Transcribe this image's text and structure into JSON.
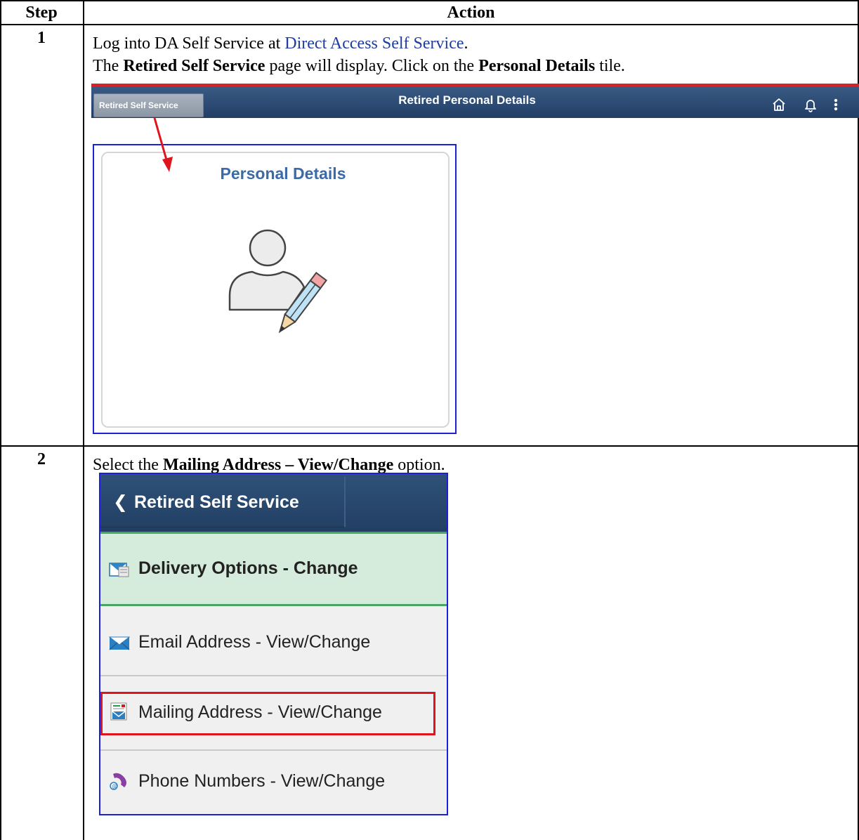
{
  "table": {
    "headers": {
      "step": "Step",
      "action": "Action"
    },
    "rows": [
      {
        "step": "1",
        "line1": {
          "prefix": "Log into DA Self Service at ",
          "link": "Direct Access Self Service",
          "suffix": "."
        },
        "line2": {
          "p1": "The ",
          "b1": "Retired Self Service",
          "p2": " page will display. Click on the ",
          "b2": "Personal Details",
          "p3": " tile."
        }
      },
      {
        "step": "2",
        "line1": {
          "p1": "Select the ",
          "b1": "Mailing Address – View/Change",
          "p2": " option."
        }
      }
    ]
  },
  "screenshot1": {
    "back_button": "Retired Self Service",
    "title": "Retired Personal Details",
    "icons": [
      "home-icon",
      "bell-icon",
      "more-vertical-icon"
    ],
    "tile_title": "Personal Details",
    "tile_icon": "person-edit-icon",
    "arrow_color": "#e0141c"
  },
  "screenshot2": {
    "back_label": "Retired Self Service",
    "items": [
      {
        "label": "Delivery Options - Change",
        "icon": "delivery-options-icon",
        "active": true
      },
      {
        "label": "Email Address - View/Change",
        "icon": "email-icon"
      },
      {
        "label": "Mailing Address - View/Change",
        "icon": "mailing-address-icon",
        "highlighted": true
      },
      {
        "label": "Phone Numbers - View/Change",
        "icon": "phone-icon"
      }
    ],
    "highlight_color": "#e0141c",
    "active_color": "#d5ecdc"
  }
}
